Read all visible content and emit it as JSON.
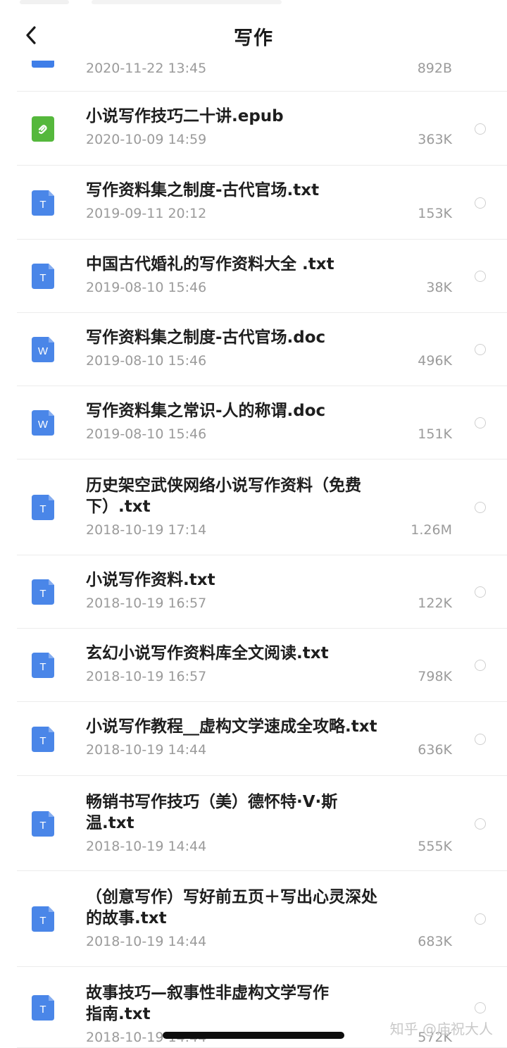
{
  "header": {
    "title": "写作",
    "back_icon": "chevron-left-icon"
  },
  "colors": {
    "doc_blue": "#4a86e8",
    "epub_green": "#55b83c",
    "text_primary": "#1e1e1e",
    "text_secondary": "#9b9b9b"
  },
  "files": [
    {
      "name": "",
      "date": "2020-11-22 13:45",
      "size": "892B",
      "type": "partial"
    },
    {
      "name": "小说写作技巧二十讲.epub",
      "date": "2020-10-09 14:59",
      "size": "363K",
      "type": "epub",
      "icon": "epub-file-icon"
    },
    {
      "name": "写作资料集之制度-古代官场.txt",
      "date": "2019-09-11 20:12",
      "size": "153K",
      "type": "txt",
      "icon": "txt-file-icon",
      "badge": "T"
    },
    {
      "name": "中国古代婚礼的写作资料大全 .txt",
      "date": "2019-08-10 15:46",
      "size": "38K",
      "type": "txt",
      "icon": "txt-file-icon",
      "badge": "T"
    },
    {
      "name": "写作资料集之制度-古代官场.doc",
      "date": "2019-08-10 15:46",
      "size": "496K",
      "type": "doc",
      "icon": "word-file-icon",
      "badge": "W"
    },
    {
      "name": "写作资料集之常识-人的称谓.doc",
      "date": "2019-08-10 15:46",
      "size": "151K",
      "type": "doc",
      "icon": "word-file-icon",
      "badge": "W"
    },
    {
      "name": "历史架空武侠网络小说写作资料（免费下）.txt",
      "date": "2018-10-19 17:14",
      "size": "1.26M",
      "type": "txt",
      "icon": "txt-file-icon",
      "badge": "T"
    },
    {
      "name": "小说写作资料.txt",
      "date": "2018-10-19 16:57",
      "size": "122K",
      "type": "txt",
      "icon": "txt-file-icon",
      "badge": "T"
    },
    {
      "name": "玄幻小说写作资料库全文阅读.txt",
      "date": "2018-10-19 16:57",
      "size": "798K",
      "type": "txt",
      "icon": "txt-file-icon",
      "badge": "T"
    },
    {
      "name": "小说写作教程__虚构文学速成全攻略.txt",
      "date": "2018-10-19 14:44",
      "size": "636K",
      "type": "txt",
      "icon": "txt-file-icon",
      "badge": "T"
    },
    {
      "name": "畅销书写作技巧（美）德怀特·V·斯温.txt",
      "date": "2018-10-19 14:44",
      "size": "555K",
      "type": "txt",
      "icon": "txt-file-icon",
      "badge": "T"
    },
    {
      "name": "（创意写作）写好前五页＋写出心灵深处的故事.txt",
      "date": "2018-10-19 14:44",
      "size": "683K",
      "type": "txt",
      "icon": "txt-file-icon",
      "badge": "T"
    },
    {
      "name": "故事技巧—叙事性非虚构文学写作指南.txt",
      "date": "2018-10-19 14:44",
      "size": "572K",
      "type": "txt",
      "icon": "txt-file-icon",
      "badge": "T"
    }
  ],
  "watermark": "知乎 @庙祝大人"
}
